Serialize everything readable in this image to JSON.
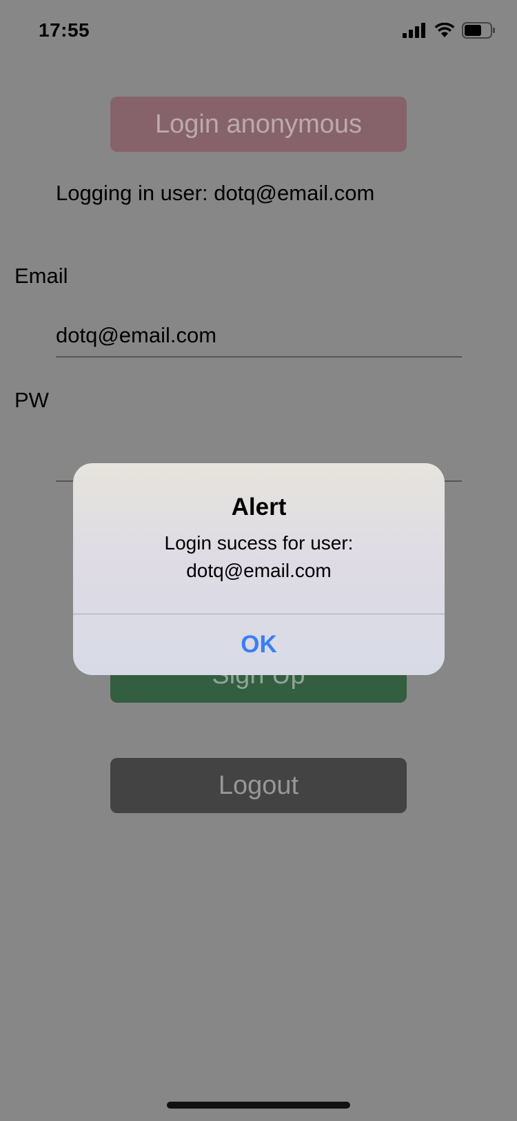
{
  "statusbar": {
    "time": "17:55",
    "icons": [
      "signal-icon",
      "wifi-icon",
      "battery-icon"
    ]
  },
  "buttons": {
    "login_anonymous": "Login anonymous",
    "sign_up": "Sign Up",
    "logout": "Logout"
  },
  "status_text": "Logging in user: dotq@email.com",
  "form": {
    "email_label": "Email",
    "email_value": "dotq@email.com",
    "pw_label": "PW",
    "pw_value": ""
  },
  "alert": {
    "title": "Alert",
    "message_line1": "Login sucess for user:",
    "message_line2": "dotq@email.com",
    "ok_label": "OK"
  },
  "colors": {
    "overlay": "#878787",
    "anon_button": "#86636b",
    "signup_button": "#335e40",
    "logout_button": "#434343",
    "alert_action": "#3a7ef3"
  }
}
